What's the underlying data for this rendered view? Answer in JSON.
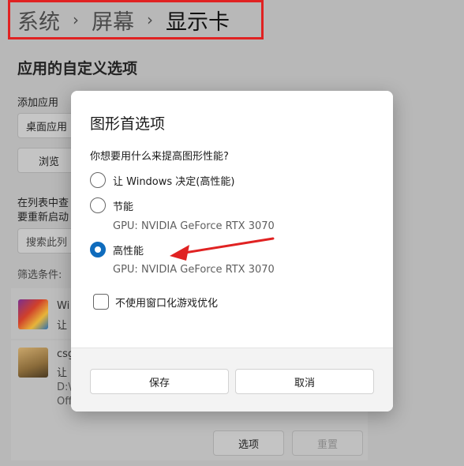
{
  "breadcrumb": {
    "items": [
      "系统",
      "屏幕",
      "显示卡"
    ],
    "separator": "›"
  },
  "background": {
    "heading": "应用的自定义选项",
    "add_app_label": "添加应用",
    "desktop_app_select": "桌面应用",
    "browse_button": "浏览",
    "list_hint_line1": "在列表中查",
    "list_hint_line2": "要重新启动",
    "search_placeholder": "搜索此列",
    "filter_label": "筛选条件:",
    "apps": [
      {
        "name": "Wi",
        "sub": "让"
      },
      {
        "name": "csg",
        "sub": "让",
        "path": "D:\\",
        "extra": "Off"
      }
    ],
    "options_button": "选项",
    "reset_button": "重置"
  },
  "dialog": {
    "title": "图形首选项",
    "question": "你想要用什么来提高图形性能?",
    "options": [
      {
        "label": "让 Windows 决定(高性能)",
        "gpu": "",
        "checked": false
      },
      {
        "label": "节能",
        "gpu": "GPU: NVIDIA GeForce RTX 3070",
        "checked": false
      },
      {
        "label": "高性能",
        "gpu": "GPU: NVIDIA GeForce RTX 3070",
        "checked": true
      }
    ],
    "checkbox_label": "不使用窗口化游戏优化",
    "checkbox_checked": false,
    "save_button": "保存",
    "cancel_button": "取消"
  },
  "colors": {
    "accent": "#0f6cbd",
    "highlight_box": "#e02222",
    "arrow": "#e02222"
  }
}
